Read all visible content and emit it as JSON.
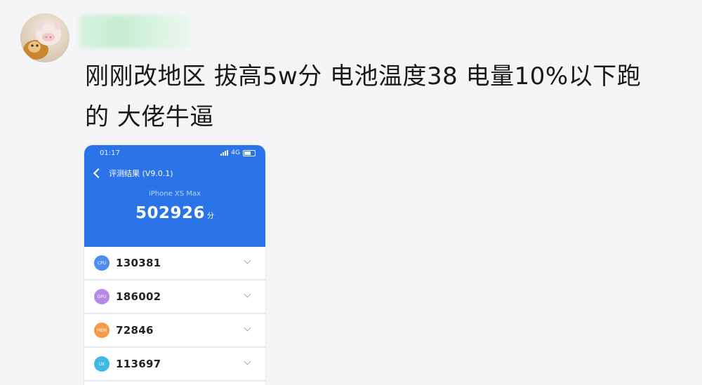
{
  "post": {
    "text": "刚刚改地区 拔高5w分 电池温度38 电量10%以下跑\n的 大佬牛逼"
  },
  "screenshot": {
    "status_time": "01:17",
    "network": "4G",
    "nav_title": "评测结果 (V9.0.1)",
    "device_name": "iPhone XS Max",
    "total_score": "502926",
    "score_unit": "分",
    "rows": [
      {
        "badge": "CPU",
        "value": "130381",
        "color": "#4c8ef0"
      },
      {
        "badge": "GPU",
        "value": "186002",
        "color": "#b489e8"
      },
      {
        "badge": "MEM",
        "value": "72846",
        "color": "#f59a47"
      },
      {
        "badge": "UX",
        "value": "113697",
        "color": "#3fb8e6"
      }
    ]
  },
  "icons": {
    "avatar": "cat-with-pig-mask-avatar",
    "back": "chevron-left-icon",
    "expand": "chevron-down-icon",
    "signal": "signal-bars-icon",
    "battery": "battery-icon"
  },
  "colors": {
    "header_blue": "#2a73e8",
    "background": "#f5f5f8"
  }
}
